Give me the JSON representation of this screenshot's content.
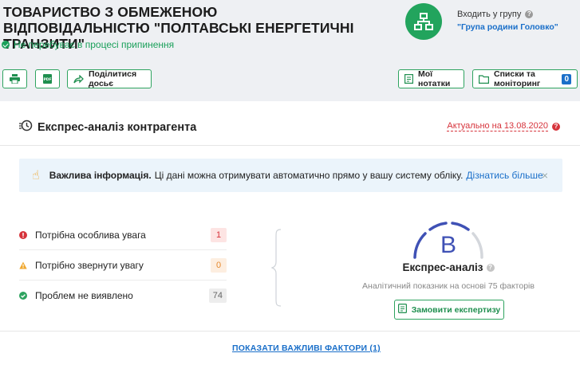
{
  "company": {
    "name": "ТОВАРИСТВО З ОБМЕЖЕНОЮ ВІДПОВІДАЛЬНІСТЮ \"ПОЛТАВСЬКІ ЕНЕРГЕТИЧНІ ТРАНЗИТИ\"",
    "status": "Не перебуває в процесі припинення"
  },
  "group": {
    "label": "Входить у групу",
    "help": "?",
    "link": "\"Група родини Головко\""
  },
  "toolbar": {
    "print_icon": "printer-icon",
    "pdf_icon": "pdf-icon",
    "share_label": "Поділитися досьє",
    "notes_label": "Мої нотатки",
    "lists_label": "Списки та моніторинг",
    "lists_count": "0"
  },
  "panel": {
    "title": "Експрес-аналіз контрагента",
    "actual": "Актуально на 13.08.2020",
    "actual_help": "?"
  },
  "info": {
    "bold": "Важлива інформація.",
    "text": "Ці дані можна отримувати автоматично прямо у вашу систему обліку.",
    "link": "Дізнатись більше",
    "close": "×"
  },
  "risks": [
    {
      "label": "Потрібна особлива увага",
      "count": "1",
      "color": "#d6333b"
    },
    {
      "label": "Потрібно звернути увагу",
      "count": "0",
      "color": "#f0a830"
    },
    {
      "label": "Проблем не виявлено",
      "count": "74",
      "color": "#2ea35f"
    }
  ],
  "gauge": {
    "grade": "B",
    "grade_level_fraction": 0.6,
    "title": "Експрес-аналіз",
    "help": "?",
    "subtitle": "Аналітичний показник на основі 75 факторів",
    "order_label": "Замовити експертизу"
  },
  "footer": {
    "show_factors": "ПОКАЗАТИ ВАЖЛИВІ ФАКТОРИ (1)"
  },
  "colors": {
    "accent_green": "#2ea35f",
    "link_blue": "#1a6fc9",
    "gauge_blue": "#3f51b5"
  }
}
